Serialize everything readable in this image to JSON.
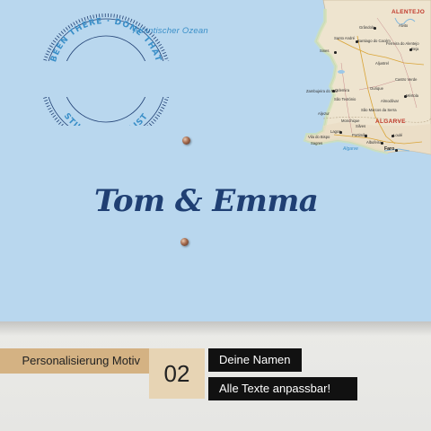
{
  "map": {
    "ocean_label": "Atlantischer Ozean",
    "sea_label": "Algarve",
    "regions": [
      "ALENTEJO",
      "ALGARVE"
    ],
    "cities": [
      {
        "name": "Sines",
        "big": false
      },
      {
        "name": "Santo André",
        "big": false
      },
      {
        "name": "Santiago do Cacém",
        "big": false
      },
      {
        "name": "Grândola",
        "big": false
      },
      {
        "name": "Alvito",
        "big": false
      },
      {
        "name": "Ferreira do Alentejo",
        "big": false
      },
      {
        "name": "Beja",
        "big": false
      },
      {
        "name": "Aljustrel",
        "big": false
      },
      {
        "name": "Castro Verde",
        "big": false
      },
      {
        "name": "Mértola",
        "big": false
      },
      {
        "name": "Ourique",
        "big": false
      },
      {
        "name": "Zambujeira do Mar",
        "big": false
      },
      {
        "name": "Odemira",
        "big": false
      },
      {
        "name": "Almodôvar",
        "big": false
      },
      {
        "name": "São Teotónio",
        "big": false
      },
      {
        "name": "São Marcos da Serra",
        "big": false
      },
      {
        "name": "Aljezur",
        "big": false
      },
      {
        "name": "Monchique",
        "big": false
      },
      {
        "name": "Vila do Bispo",
        "big": false
      },
      {
        "name": "Lagos",
        "big": false
      },
      {
        "name": "Portimão",
        "big": false
      },
      {
        "name": "Silves",
        "big": false
      },
      {
        "name": "Albufeira",
        "big": false
      },
      {
        "name": "Loulé",
        "big": false
      },
      {
        "name": "Sagres",
        "big": false
      },
      {
        "name": "Faro",
        "big": true
      }
    ]
  },
  "badge": {
    "top_text": "BEEN THERE · DONE THAT",
    "bottom_text": "STILL ON THE LIST",
    "names": "Tom & Emma"
  },
  "labels": {
    "motif_label": "Personalisierung Motiv",
    "number": "02",
    "names_label": "Deine Namen",
    "texts_label": "Alle Texte anpassbar!"
  },
  "colors": {
    "ocean": "#b9d7ee",
    "land": "#eee4cf",
    "badge_navy": "#1f3f73",
    "badge_blue": "#3a8fc8",
    "label_tan": "#d4b283",
    "label_black": "#111111"
  }
}
